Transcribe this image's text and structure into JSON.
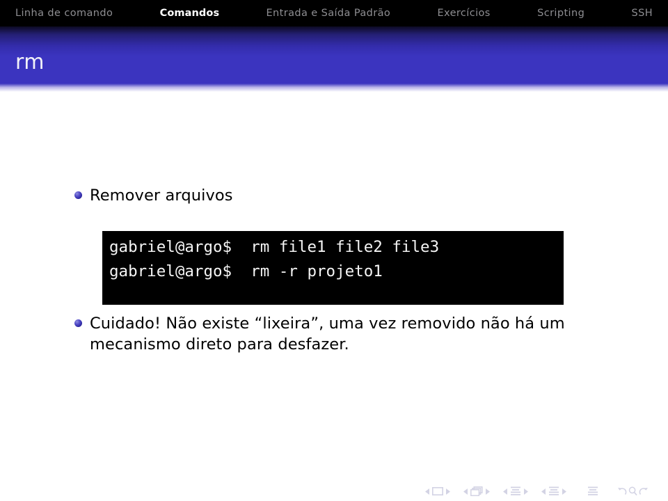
{
  "navbar": {
    "items": [
      {
        "label": "Linha de comando",
        "active": false
      },
      {
        "label": "Comandos",
        "active": true
      },
      {
        "label": "Entrada e Saída Padrão",
        "active": false
      },
      {
        "label": "Exercícios",
        "active": false
      },
      {
        "label": "Scripting",
        "active": false
      },
      {
        "label": "SSH",
        "active": false
      }
    ],
    "active_color": "#ffffff",
    "inactive_color": "#8e8e92",
    "background": "#000000"
  },
  "title": {
    "text": "rm",
    "color": "#f2f2f8",
    "bar_gradient_from": "#0c0a22",
    "bar_gradient_to": "#3b34bf"
  },
  "slide": {
    "bullets": [
      {
        "text": "Remover arquivos"
      },
      {
        "text": "Cuidado! Não existe “lixeira”, uma vez removido não há um mecanismo direto para desfazer."
      }
    ],
    "bullet_color": "#3b34bf",
    "code_block": {
      "background": "#000000",
      "foreground": "#f4f4f4",
      "lines": [
        "gabriel@argo$  rm file1 file2 file3",
        "gabriel@argo$  rm -r projeto1"
      ]
    }
  },
  "navigation_symbols": {
    "color": "#d3d3e4",
    "groups": [
      {
        "name": "slide",
        "icon": "slide-icon"
      },
      {
        "name": "frame",
        "icon": "frame-icon"
      },
      {
        "name": "subsection",
        "icon": "subsection-icon"
      },
      {
        "name": "section",
        "icon": "section-icon"
      },
      {
        "name": "document",
        "icon": "document-icon"
      }
    ],
    "actions": [
      {
        "name": "back",
        "icon": "back-icon"
      },
      {
        "name": "search",
        "icon": "search-icon"
      },
      {
        "name": "forward",
        "icon": "forward-icon"
      }
    ]
  }
}
